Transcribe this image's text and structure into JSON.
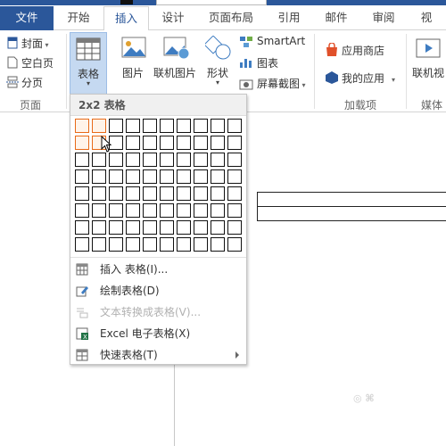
{
  "tabs": [
    "文件",
    "开始",
    "插入",
    "设计",
    "页面布局",
    "引用",
    "邮件",
    "审阅",
    "视"
  ],
  "ribbon": {
    "pages_group": {
      "cover": "封面",
      "blank_page": "空白页",
      "page_break": "分页",
      "label": "页面"
    },
    "table_button": "表格",
    "illustrations": {
      "picture": "图片",
      "online_picture": "联机图片",
      "shapes": "形状",
      "smartart": "SmartArt",
      "chart": "图表",
      "screenshot": "屏幕截图"
    },
    "addins": {
      "store": "应用商店",
      "my_apps": "我的应用",
      "label": "加载项"
    },
    "media": {
      "online_video": "联机视",
      "label": "媒体"
    }
  },
  "dropdown": {
    "header": "2x2 表格",
    "grid_cols": 10,
    "grid_rows": 8,
    "selected_cols": 2,
    "selected_rows": 2,
    "menu": [
      {
        "label": "插入 表格(I)...",
        "enabled": true,
        "icon": "insert-table-icon"
      },
      {
        "label": "绘制表格(D)",
        "enabled": true,
        "icon": "draw-table-pencil-icon"
      },
      {
        "label": "文本转换成表格(V)...",
        "enabled": false,
        "icon": "text-to-table-icon"
      },
      {
        "label": "Excel 电子表格(X)",
        "enabled": true,
        "icon": "excel-icon"
      },
      {
        "label": "快速表格(T)",
        "enabled": true,
        "icon": "quick-table-icon"
      }
    ]
  },
  "colors": {
    "accent": "#2b579a",
    "selection": "#e86a18"
  }
}
